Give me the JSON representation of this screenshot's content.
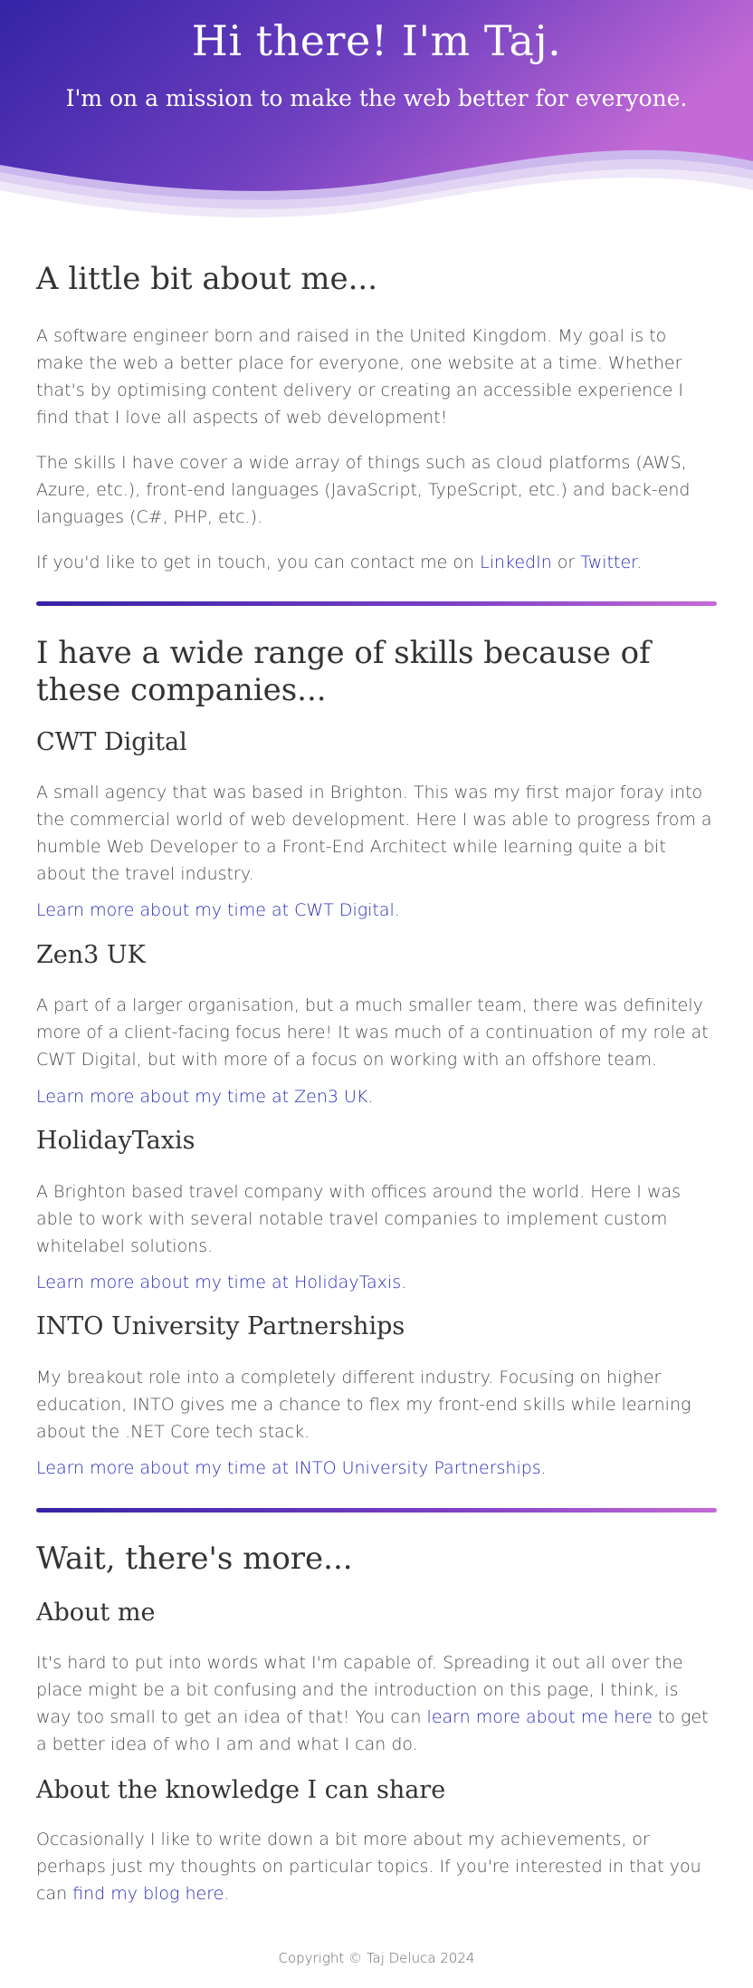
{
  "colors": {
    "gradient_start": "#3423a6",
    "gradient_end": "#c46ad6",
    "link": "#2a2ab8",
    "text": "#4a4a4a"
  },
  "hero": {
    "title": "Hi there! I'm Taj.",
    "subtitle": "I'm on a mission to make the web better for everyone."
  },
  "about": {
    "heading": "A little bit about me...",
    "p1": "A software engineer born and raised in the United Kingdom. My goal is to make the web a better place for everyone, one website at a time. Whether that's by optimising content delivery or creating an accessible experience I find that I love all aspects of web development!",
    "p2": "The skills I have cover a wide array of things such as cloud platforms (AWS, Azure, etc.), front-end languages (JavaScript, TypeScript, etc.) and back-end languages (C#, PHP, etc.).",
    "contact_prefix": "If you'd like to get in touch, you can contact me on ",
    "linkedin": "LinkedIn",
    "contact_or": " or ",
    "twitter": "Twitter",
    "contact_suffix": "."
  },
  "companies": {
    "heading": "I have a wide range of skills because of these companies...",
    "items": [
      {
        "name": "CWT Digital",
        "description": "A small agency that was based in Brighton. This was my first major foray into the commercial world of web development. Here I was able to progress from a humble Web Developer to a Front-End Architect while learning quite a bit about the travel industry.",
        "link": "Learn more about my time at CWT Digital."
      },
      {
        "name": "Zen3 UK",
        "description": "A part of a larger organisation, but a much smaller team, there was definitely more of a client-facing focus here! It was much of a continuation of my role at CWT Digital, but with more of a focus on working with an offshore team.",
        "link": "Learn more about my time at Zen3 UK."
      },
      {
        "name": "HolidayTaxis",
        "description": "A Brighton based travel company with offices around the world. Here I was able to work with several notable travel companies to implement custom whitelabel solutions.",
        "link": "Learn more about my time at HolidayTaxis."
      },
      {
        "name": "INTO University Partnerships",
        "description": "My breakout role into a completely different industry. Focusing on higher education, INTO gives me a chance to flex my front-end skills while learning about the .NET Core tech stack.",
        "link": "Learn more about my time at INTO University Partnerships."
      }
    ]
  },
  "more": {
    "heading": "Wait, there's more...",
    "about_heading": "About me",
    "about_prefix": "It's hard to put into words what I'm capable of. Spreading it out all over the place might be a bit confusing and the introduction on this page, I think, is way too small to get an idea of that! You can ",
    "about_link": "learn more about me here",
    "about_suffix": " to get a better idea of who I am and what I can do.",
    "knowledge_heading": "About the knowledge I can share",
    "knowledge_prefix": "Occasionally I like to write down a bit more about my achievements, or perhaps just my thoughts on particular topics. If you're interested in that you can ",
    "knowledge_link": "find my blog here",
    "knowledge_suffix": "."
  },
  "footer": {
    "copyright": "Copyright © Taj Deluca 2024"
  }
}
